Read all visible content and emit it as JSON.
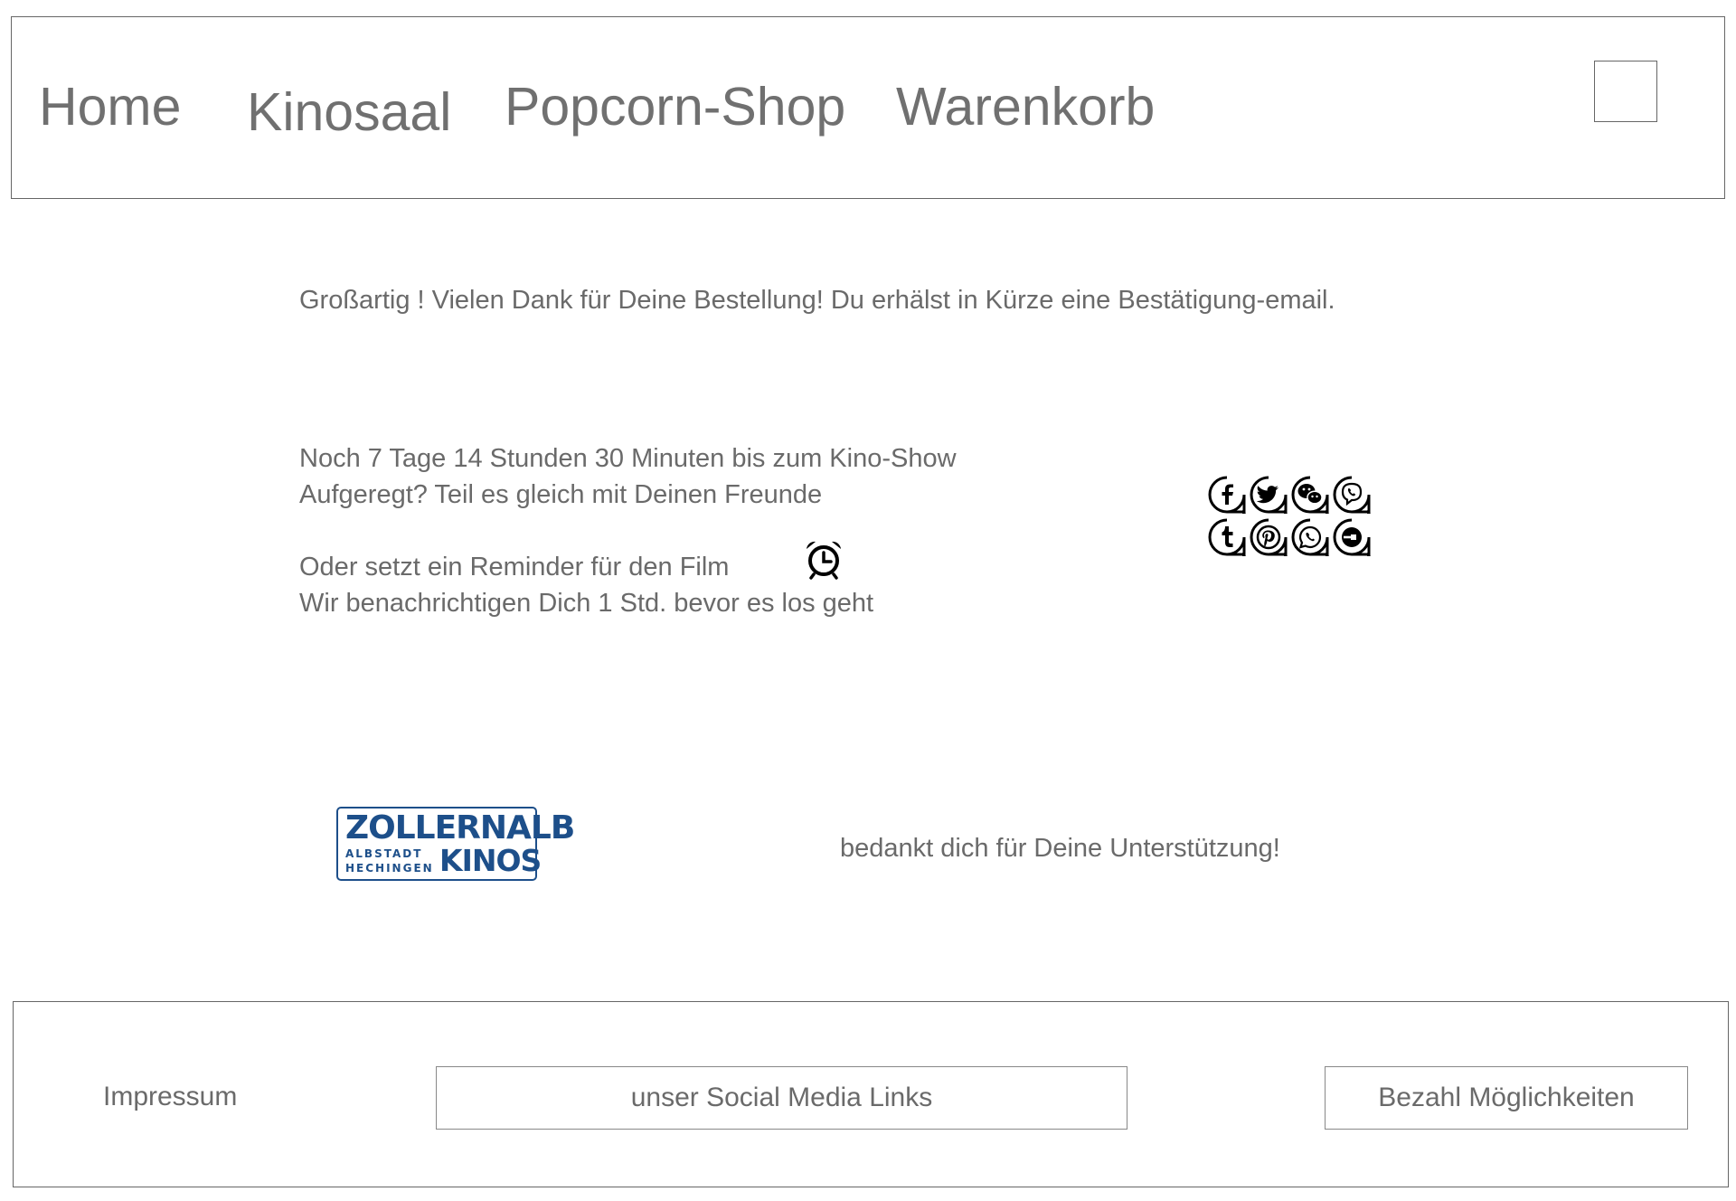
{
  "nav": {
    "home": "Home",
    "kinosaal": "Kinosaal",
    "shop": "Popcorn-Shop",
    "cart": "Warenkorb"
  },
  "confirmation": "Großartig ! Vielen Dank für Deine Bestellung! Du erhälst in Kürze eine Bestätigung-email.",
  "countdown": {
    "line1": "Noch 7 Tage 14 Stunden 30 Minuten bis zum Kino-Show",
    "line2": "Aufgeregt? Teil es gleich mit Deinen Freunde"
  },
  "reminder": {
    "line1": "Oder setzt ein Reminder für den Film",
    "line2": "Wir benachrichtigen Dich 1 Std. bevor es los geht"
  },
  "logo": {
    "top": "ZOLLERNALB",
    "line_a": "ALBSTADT",
    "line_b": "HECHINGEN",
    "big": "KINOS"
  },
  "thanks": "bedankt dich für Deine Unterstützung!",
  "footer": {
    "impressum": "Impressum",
    "social": "unser Social Media Links",
    "payment": "Bezahl Möglichkeiten"
  },
  "icons": {
    "reminder": "alarm-clock-icon",
    "social": [
      "facebook-icon",
      "twitter-icon",
      "wechat-icon",
      "viber-icon",
      "tumblr-icon",
      "pinterest-icon",
      "whatsapp-icon",
      "uber-icon"
    ]
  }
}
